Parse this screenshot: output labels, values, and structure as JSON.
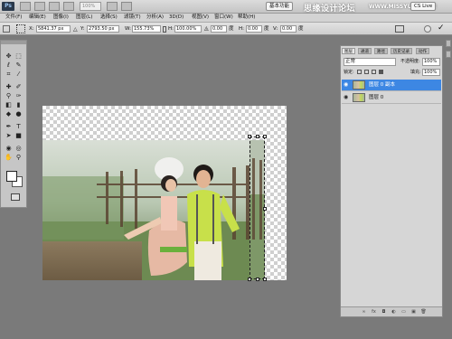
{
  "appbar": {
    "logo": "Ps",
    "zoom_value": "100%",
    "workspace_button": "基本功能",
    "cs_live": "CS Live",
    "watermark_cn": "思缘设计论坛",
    "watermark_url": "WWW.MISSYUAN.COM"
  },
  "menu": [
    "文件(F)",
    "编辑(E)",
    "图像(I)",
    "图层(L)",
    "选择(S)",
    "滤镜(T)",
    "分析(A)",
    "3D(D)",
    "视图(V)",
    "窗口(W)",
    "帮助(H)"
  ],
  "options": {
    "x_label": "X:",
    "x_value": "5841.37 px",
    "y_label": "Y:",
    "y_value": "2793.50 px",
    "w_label": "W:",
    "w_value": "155.73%",
    "h_label": "H:",
    "h_value": "100.00%",
    "angle_value": "0.00",
    "angle_unit": "度",
    "h2_label": "H:",
    "h2_value": "0.00",
    "h2_unit": "度",
    "v_label": "V:",
    "v_value": "0.00",
    "v_unit": "度"
  },
  "layers_panel": {
    "tabs": [
      "图层",
      "通道",
      "路径",
      "历史记录",
      "动作"
    ],
    "blend_mode": "正常",
    "opacity_label": "不透明度:",
    "opacity_value": "100%",
    "lock_label": "锁定:",
    "fill_label": "填充:",
    "fill_value": "100%",
    "layers": [
      {
        "name": "图层 0 副本",
        "selected": true
      },
      {
        "name": "图层 0",
        "selected": false
      }
    ]
  },
  "colors": {
    "accent": "#3d87e3",
    "app_bg": "#7a7a7a",
    "panel_bg": "#d6d6d6"
  }
}
